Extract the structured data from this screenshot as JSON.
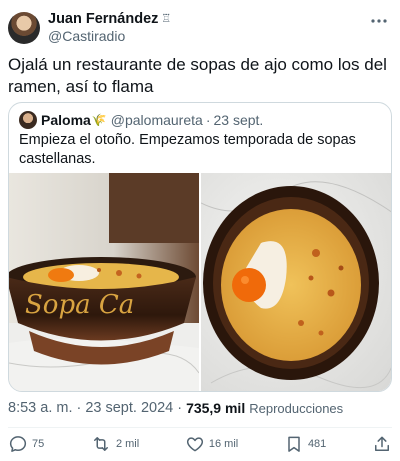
{
  "author": {
    "display_name": "Juan Fernández",
    "name_badge": "♖",
    "handle": "@Castiradio"
  },
  "more_icon": "ellipsis-icon",
  "tweet_text": "Ojalá un restaurante de sopas de ajo como los del ramen, así to flama",
  "quoted": {
    "display_name": "Paloma",
    "emoji": "🌾",
    "handle": "@palomaureta",
    "separator": "·",
    "date": "23 sept.",
    "text": "Empieza el otoño. Empezamos temporada de sopas castellanas.",
    "bowl_lettering": "Sopa Ca"
  },
  "meta": {
    "time": "8:53 a. m.",
    "separator": "·",
    "date": "23 sept. 2024",
    "views_count": "735,9 mil",
    "views_label": "Reproducciones"
  },
  "actions": {
    "replies": "75",
    "retweets": "2 mil",
    "likes": "16 mil",
    "bookmarks": "481"
  },
  "colors": {
    "text_primary": "#0f1419",
    "text_secondary": "#536471",
    "border": "#cfd9de",
    "divider": "#eff3f4"
  }
}
